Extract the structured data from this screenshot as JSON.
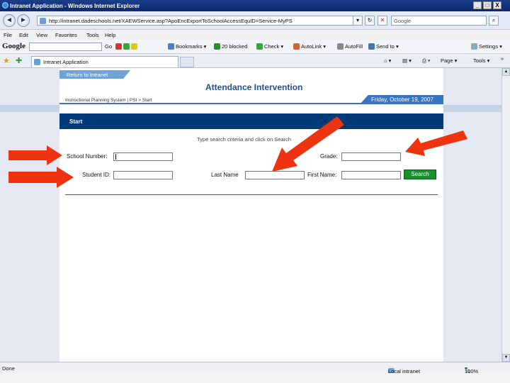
{
  "window": {
    "title": "Intranet Application - Windows Internet Explorer",
    "minimize": "_",
    "maximize": "□",
    "close": "X"
  },
  "address_bar": {
    "url": "http://intranet.dadeschools.net/XAEWService.asp?ApoEncExportToSchoolAccessEquID=Service-MyPS",
    "search_placeholder": "Google"
  },
  "menu": [
    "File",
    "Edit",
    "View",
    "Favorites",
    "Tools",
    "Help"
  ],
  "google_toolbar": {
    "logo": "Google",
    "go": "Go",
    "items": [
      "Bookmarks ▾",
      "20 blocked",
      "Check ▾",
      "AutoLink ▾",
      "AutoFill",
      "Send to ▾",
      "Settings ▾"
    ]
  },
  "tabbar": {
    "tab_label": "Intranet Application",
    "commands": [
      "Page ▾",
      "Tools ▾"
    ],
    "more": "»"
  },
  "page": {
    "return_link": "Return to Intranet",
    "title": "Attendance Intervention",
    "breadcrumb": "Instructional Planning System | PSI > Start",
    "date": "Friday, October 19, 2007",
    "section": "Start",
    "instructions": "Type search criteria and click on Search",
    "labels": {
      "school_number": "School Number:",
      "grade": "Grade:",
      "student_id": "Student ID:",
      "last_name": "Last Name",
      "first_name": "First Name:"
    },
    "search_button": "Search"
  },
  "status_bar": {
    "status": "Done",
    "zone": "Local intranet",
    "zoom": "100%"
  },
  "colors": {
    "title_blue": "#1f4e9a",
    "start_bar": "#003a78",
    "search_button": "#1a8f2e",
    "arrow": "#ee3311"
  }
}
